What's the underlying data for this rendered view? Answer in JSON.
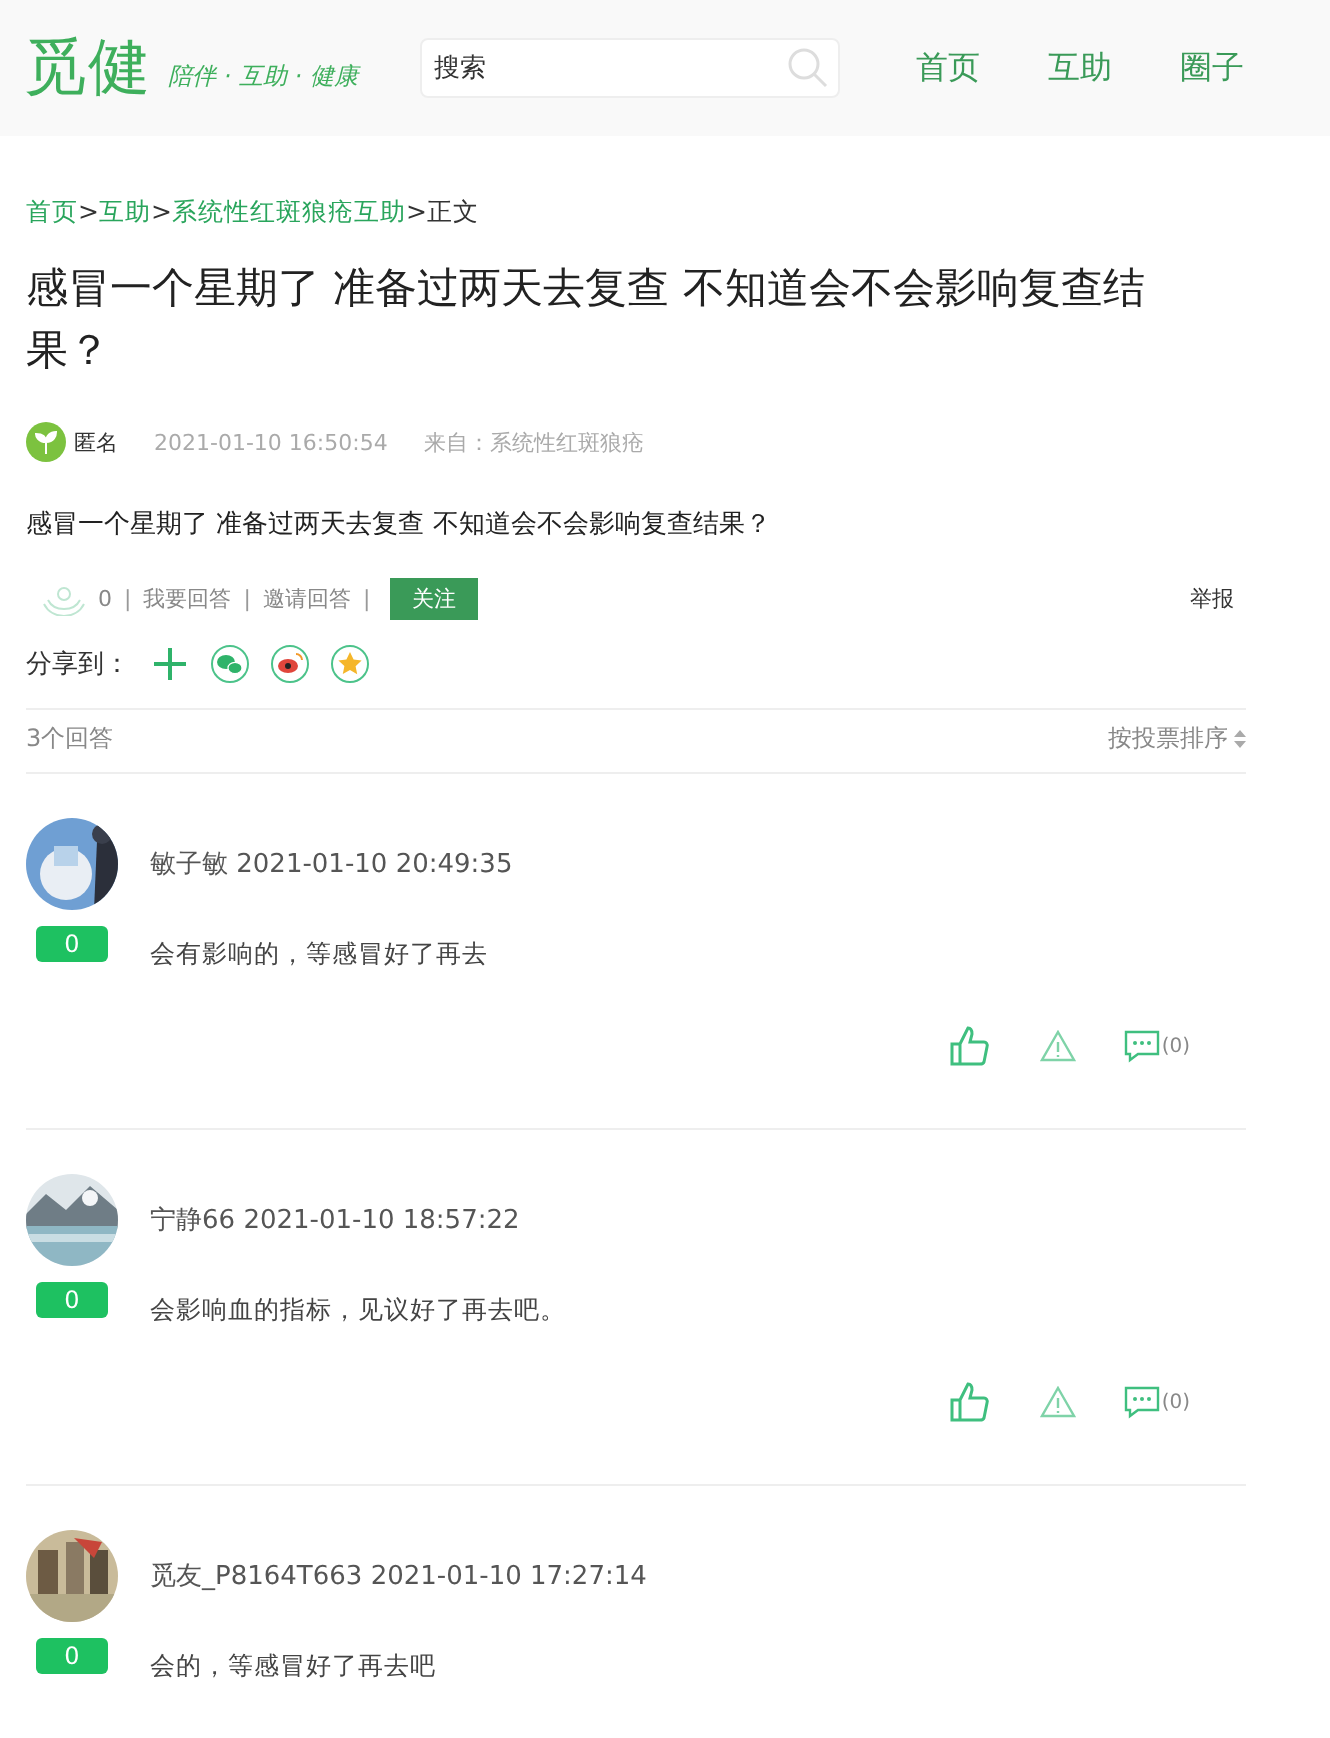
{
  "header": {
    "logo": "觅健",
    "slogan": "陪伴 · 互助 · 健康",
    "search": {
      "placeholder": "搜索"
    },
    "nav": [
      {
        "label": "首页"
      },
      {
        "label": "互助"
      },
      {
        "label": "圈子"
      }
    ]
  },
  "breadcrumb": {
    "separator": ">",
    "items": [
      {
        "label": "首页",
        "kind": "link"
      },
      {
        "label": "互助",
        "kind": "link"
      },
      {
        "label": "系统性红斑狼疮互助",
        "kind": "link"
      },
      {
        "label": "正文",
        "kind": "current"
      }
    ]
  },
  "question": {
    "title": "感冒一个星期了 准备过两天去复查 不知道会不会影响复查结果？",
    "author": "匿名",
    "time": "2021-01-10 16:50:54",
    "source": "来自：系统性红斑狼疮",
    "body": "感冒一个星期了 准备过两天去复查 不知道会不会影响复查结果？",
    "count": "0",
    "separator": "|",
    "actions": [
      "我要回答",
      "邀请回答"
    ],
    "follow": "关注",
    "report": "举报",
    "share_label": "分享到："
  },
  "answers_header": {
    "count": "3个回答",
    "sort": "按投票排序"
  },
  "answers": [
    {
      "user": "敏子敏",
      "time": "2021-01-10 20:49:35",
      "votes": "0",
      "text": "会有影响的，等感冒好了再去",
      "comments": "(0)"
    },
    {
      "user": "宁静66",
      "time": "2021-01-10 18:57:22",
      "votes": "0",
      "text": "会影响血的指标，见议好了再去吧。",
      "comments": "(0)"
    },
    {
      "user": "觅友_P8164T663",
      "time": "2021-01-10 17:27:14",
      "votes": "0",
      "text": "会的，等感冒好了再去吧"
    }
  ]
}
